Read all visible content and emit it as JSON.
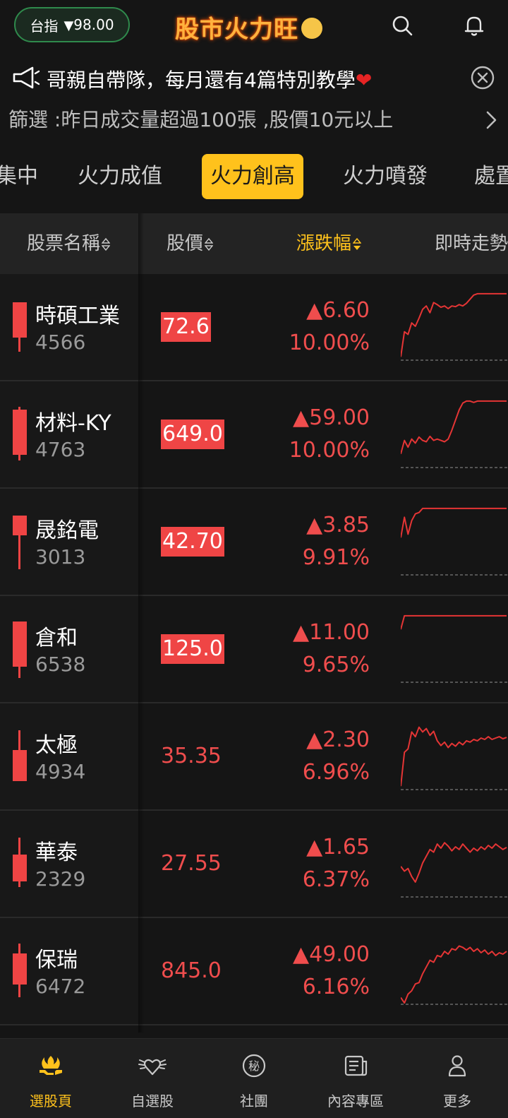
{
  "header": {
    "index_label": "台指",
    "index_arrow": "▼",
    "index_value": "98.00",
    "brand": "股市火力旺"
  },
  "announcement": {
    "text": "哥親自帶隊，每月還有4篇特別教學",
    "emoji": "❤"
  },
  "filter": {
    "text": "篩選 :昨日成交量超過100張 ,股價10元以上"
  },
  "tabs": [
    {
      "label": "集中"
    },
    {
      "label": "火力成值"
    },
    {
      "label": "火力創高"
    },
    {
      "label": "火力噴發"
    },
    {
      "label": "處置"
    }
  ],
  "active_tab": "火力創高",
  "table": {
    "columns": [
      {
        "label": "股票名稱"
      },
      {
        "label": "股價"
      },
      {
        "label": "漲跌幅"
      },
      {
        "label": "即時走勢"
      }
    ],
    "rows": [
      {
        "name": "時碩工業",
        "code": "4566",
        "price": "72.6",
        "limit_up": true,
        "change": "▲6.60",
        "pct": "10.00%",
        "trend": [
          0.05,
          0.42,
          0.38,
          0.55,
          0.5,
          0.62,
          0.75,
          0.8,
          0.7,
          0.85,
          0.82,
          0.78,
          0.8,
          0.76,
          0.8,
          0.79,
          0.82,
          0.8,
          0.84,
          0.9,
          0.96,
          0.98,
          0.98,
          0.98,
          0.98,
          0.98,
          0.98,
          0.98,
          0.98,
          0.98
        ]
      },
      {
        "name": "材料-KY",
        "code": "4763",
        "price": "649.0",
        "limit_up": true,
        "change": "▲59.00",
        "pct": "10.00%",
        "trend": [
          0.2,
          0.4,
          0.3,
          0.42,
          0.36,
          0.45,
          0.4,
          0.38,
          0.46,
          0.4,
          0.42,
          0.4,
          0.38,
          0.42,
          0.55,
          0.7,
          0.85,
          0.95,
          0.98,
          0.98,
          0.96,
          0.98,
          0.98,
          0.98,
          0.98,
          0.98,
          0.98,
          0.98,
          0.98,
          0.98
        ]
      },
      {
        "name": "晟銘電",
        "code": "3013",
        "price": "42.70",
        "limit_up": true,
        "change": "▲3.85",
        "pct": "9.91%",
        "trend": [
          0.55,
          0.85,
          0.6,
          0.8,
          0.9,
          0.92,
          0.98,
          0.98,
          0.98,
          0.98,
          0.98,
          0.98,
          0.98,
          0.98,
          0.98,
          0.98,
          0.98,
          0.98,
          0.98,
          0.98,
          0.98,
          0.98,
          0.98,
          0.98,
          0.98,
          0.98,
          0.98,
          0.98,
          0.98,
          0.98
        ]
      },
      {
        "name": "倉和",
        "code": "6538",
        "price": "125.0",
        "limit_up": true,
        "change": "▲11.00",
        "pct": "9.65%",
        "trend": [
          0.78,
          0.98,
          0.98,
          0.98,
          0.98,
          0.98,
          0.98,
          0.98,
          0.98,
          0.98,
          0.98,
          0.98,
          0.98,
          0.98,
          0.98,
          0.98,
          0.98,
          0.98,
          0.98,
          0.98,
          0.98,
          0.98,
          0.98,
          0.98,
          0.98,
          0.98,
          0.98,
          0.98,
          0.98,
          0.98
        ]
      },
      {
        "name": "太極",
        "code": "4934",
        "price": "35.35",
        "limit_up": false,
        "change": "▲2.30",
        "pct": "6.96%",
        "trend": [
          0.05,
          0.55,
          0.6,
          0.85,
          0.78,
          0.92,
          0.85,
          0.9,
          0.8,
          0.86,
          0.72,
          0.65,
          0.7,
          0.62,
          0.68,
          0.64,
          0.7,
          0.66,
          0.72,
          0.7,
          0.74,
          0.72,
          0.76,
          0.74,
          0.78,
          0.74,
          0.76,
          0.78,
          0.75,
          0.77
        ]
      },
      {
        "name": "華泰",
        "code": "2329",
        "price": "27.55",
        "limit_up": false,
        "change": "▲1.65",
        "pct": "6.37%",
        "trend": [
          0.45,
          0.38,
          0.42,
          0.3,
          0.22,
          0.35,
          0.5,
          0.6,
          0.7,
          0.66,
          0.78,
          0.72,
          0.8,
          0.75,
          0.68,
          0.74,
          0.7,
          0.78,
          0.72,
          0.66,
          0.72,
          0.68,
          0.74,
          0.7,
          0.76,
          0.72,
          0.78,
          0.74,
          0.7,
          0.73
        ]
      },
      {
        "name": "保瑞",
        "code": "6472",
        "price": "845.0",
        "limit_up": false,
        "change": "▲49.00",
        "pct": "6.16%",
        "trend": [
          0.1,
          0.02,
          0.15,
          0.2,
          0.3,
          0.32,
          0.45,
          0.55,
          0.65,
          0.62,
          0.72,
          0.7,
          0.78,
          0.74,
          0.82,
          0.8,
          0.86,
          0.84,
          0.8,
          0.84,
          0.78,
          0.82,
          0.76,
          0.8,
          0.74,
          0.78,
          0.72,
          0.76,
          0.74,
          0.78
        ]
      }
    ]
  },
  "bottom_nav": [
    {
      "label": "選股頁",
      "icon": "stock-pick-icon"
    },
    {
      "label": "自選股",
      "icon": "winged-heart-icon"
    },
    {
      "label": "社團",
      "icon": "secret-badge-icon"
    },
    {
      "label": "內容專區",
      "icon": "news-icon"
    },
    {
      "label": "更多",
      "icon": "person-icon"
    }
  ],
  "colors": {
    "accent": "#ffc21c",
    "up": "#ef4545",
    "background": "#151515"
  }
}
